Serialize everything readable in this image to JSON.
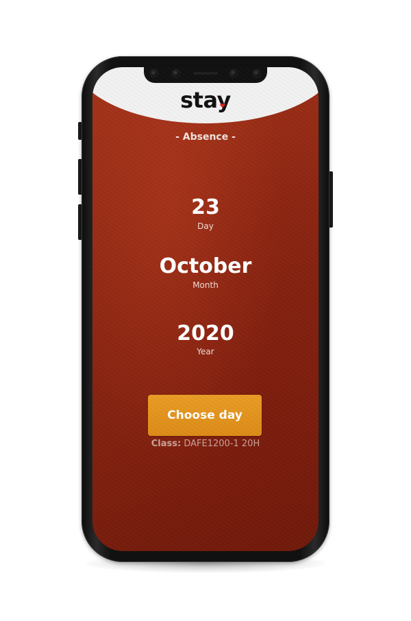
{
  "app": {
    "logo_text": "stay",
    "section_title": "- Absence -"
  },
  "date": {
    "day": {
      "value": "23",
      "label": "Day"
    },
    "month": {
      "value": "October",
      "label": "Month"
    },
    "year": {
      "value": "2020",
      "label": "Year"
    }
  },
  "actions": {
    "choose_day_label": "Choose day"
  },
  "class_info": {
    "key": "Class:",
    "value": "DAFE1200-1 20H"
  },
  "colors": {
    "background_red": "#8d2612",
    "button_orange": "#e29419",
    "header_white": "#f2f2f2",
    "logo_heart": "#d8201c"
  }
}
